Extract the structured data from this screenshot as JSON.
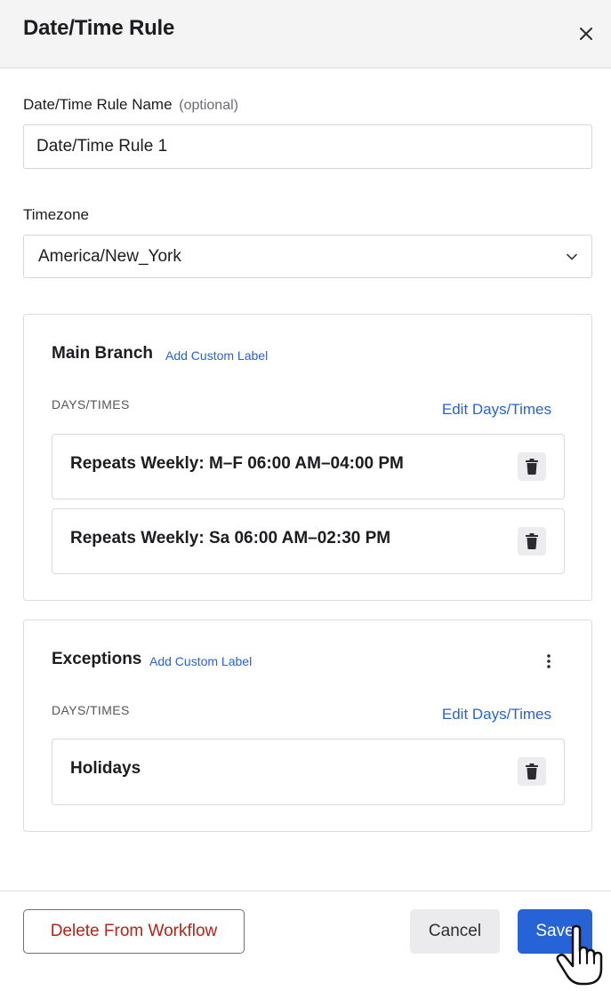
{
  "header": {
    "title": "Date/Time Rule"
  },
  "rule_name": {
    "label": "Date/Time Rule Name",
    "optional_hint": "(optional)",
    "value": "Date/Time Rule 1"
  },
  "timezone": {
    "label": "Timezone",
    "value": "America/New_York"
  },
  "main_branch": {
    "title": "Main Branch",
    "custom_label_link": "Add Custom Label",
    "section_label": "DAYS/TIMES",
    "edit_link": "Edit Days/Times",
    "rules": [
      {
        "text": "Repeats Weekly: M–F 06:00 AM–04:00 PM"
      },
      {
        "text": "Repeats Weekly: Sa 06:00 AM–02:30 PM"
      }
    ]
  },
  "exceptions": {
    "title": "Exceptions",
    "custom_label_link": "Add Custom Label",
    "section_label": "DAYS/TIMES",
    "edit_link": "Edit Days/Times",
    "rules": [
      {
        "text": "Holidays"
      }
    ]
  },
  "footer": {
    "delete_label": "Delete From Workflow",
    "cancel_label": "Cancel",
    "save_label": "Save"
  },
  "colors": {
    "accent": "#2563d6",
    "danger": "#b42318"
  }
}
